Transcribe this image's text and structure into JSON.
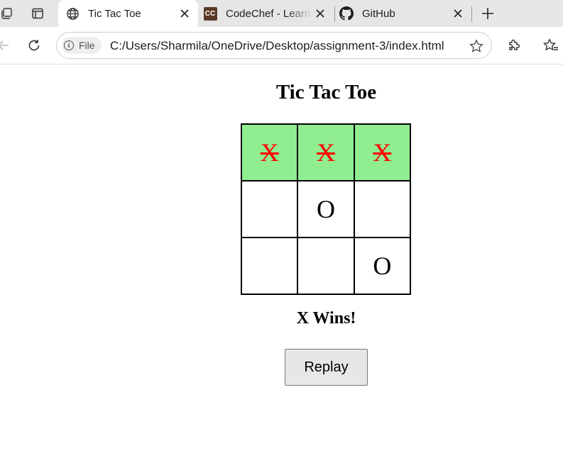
{
  "browser": {
    "tabs": [
      {
        "title": "Tic Tac Toe",
        "favicon": "globe-icon",
        "active": true
      },
      {
        "title": "CodeChef - Learn",
        "favicon": "codechef-icon",
        "favicon_text": "CC",
        "active": false
      },
      {
        "title": "GitHub",
        "favicon": "github-icon",
        "active": false
      }
    ],
    "address_bar": {
      "scheme_chip": "File",
      "url": "C:/Users/Sharmila/OneDrive/Desktop/assignment-3/index.html"
    },
    "icons": {
      "workspaces": "workspaces-icon",
      "tab_actions": "tab-actions-icon",
      "new_tab": "plus-icon",
      "back": "back-arrow-icon",
      "refresh": "refresh-icon",
      "favorite": "star-icon",
      "extensions": "puzzle-icon",
      "favorites_list": "favorites-icon"
    }
  },
  "page": {
    "title": "Tic Tac Toe",
    "board": [
      [
        "X",
        "X",
        "X"
      ],
      [
        "",
        "O",
        ""
      ],
      [
        "",
        "",
        "O"
      ]
    ],
    "winning_cells": [
      0,
      1,
      2
    ],
    "status": "X Wins!",
    "replay_label": "Replay"
  },
  "colors": {
    "win_highlight": "#90ee90",
    "win_mark": "#ff0000",
    "button_bg": "#e7e7e7",
    "tabstrip_bg": "#e6e6e6"
  }
}
